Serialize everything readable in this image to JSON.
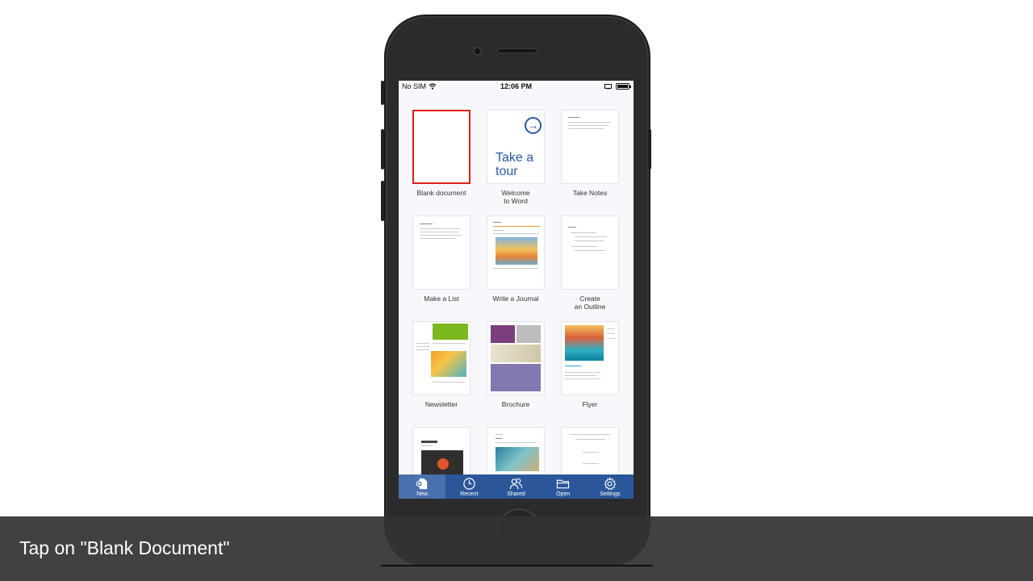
{
  "status_bar": {
    "carrier": "No SIM",
    "time": "12:06 PM"
  },
  "templates": [
    {
      "label": "Blank document",
      "selected": true
    },
    {
      "label": "Welcome\nto Word",
      "thumb_text": "Take a\ntour"
    },
    {
      "label": "Take Notes"
    },
    {
      "label": "Make a List"
    },
    {
      "label": "Write a Journal"
    },
    {
      "label": "Create\nan Outline"
    },
    {
      "label": "Newsletter"
    },
    {
      "label": "Brochure"
    },
    {
      "label": "Flyer"
    },
    {
      "label": ""
    },
    {
      "label": ""
    },
    {
      "label": ""
    }
  ],
  "tabbar": {
    "new": "New",
    "recent": "Recent",
    "shared": "Shared",
    "open": "Open",
    "settings": "Settings"
  },
  "caption": "Tap on \"Blank Document\"",
  "colors": {
    "tabbar_bg": "#2b579a",
    "selection_border": "#e01e1e",
    "tour_blue": "#2b5aa4"
  }
}
